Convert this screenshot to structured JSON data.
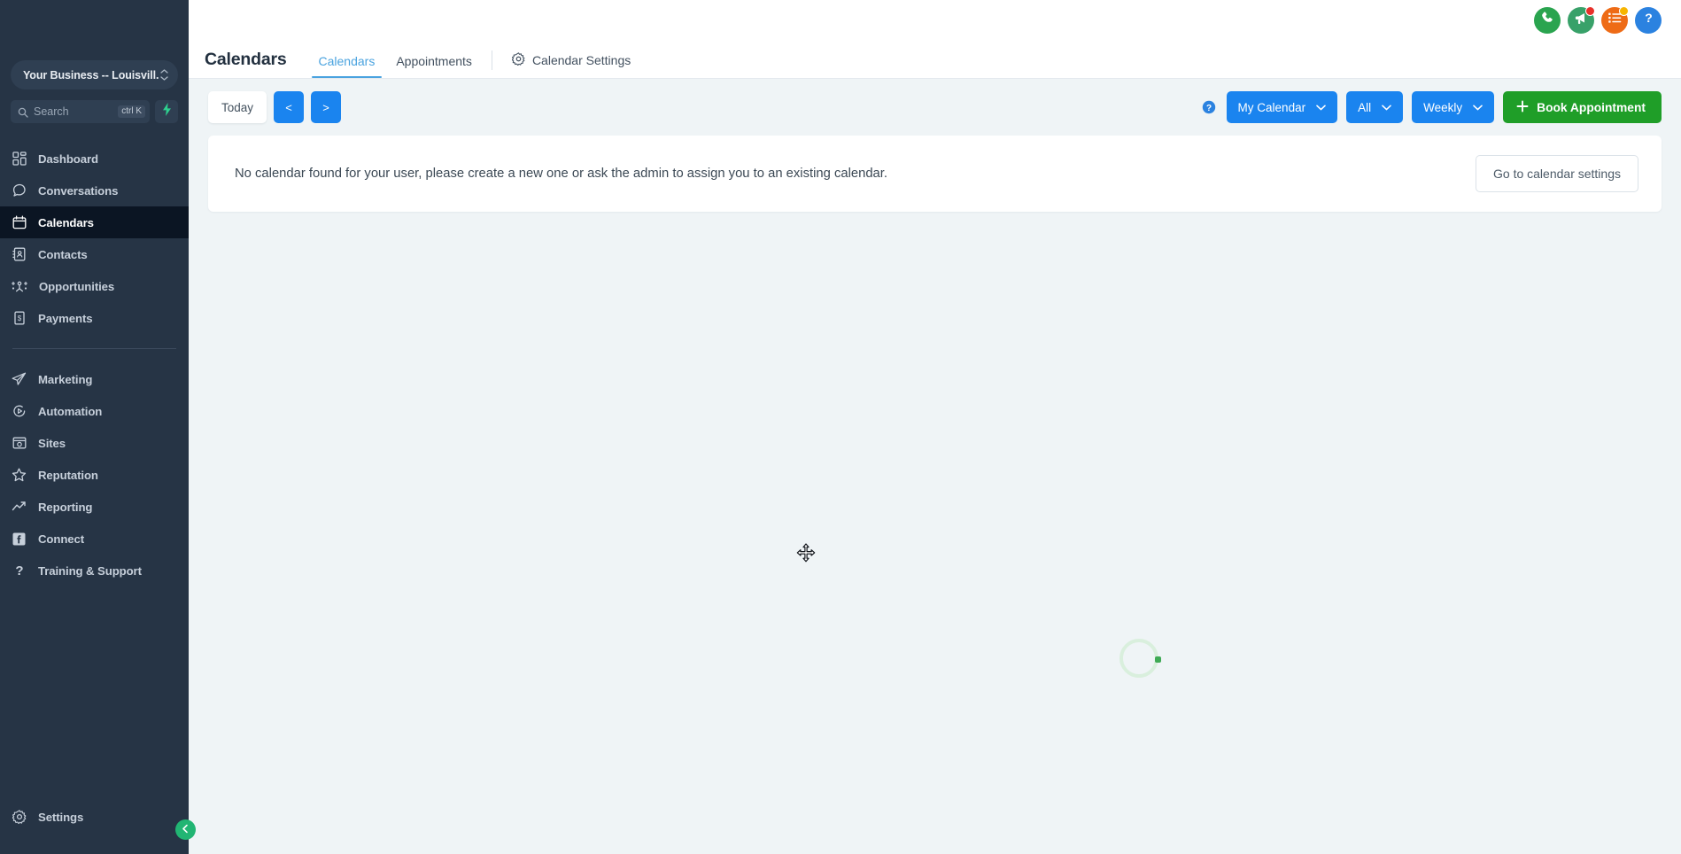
{
  "sidebar": {
    "business": {
      "name": "Your Business -- Louisvill...",
      "stepper_icon": "stepper-up-down-icon"
    },
    "search": {
      "placeholder": "Search",
      "shortcut": "ctrl K",
      "icon": "search-icon",
      "bolt_icon": "lightning-bolt-icon"
    },
    "items": [
      {
        "label": "Dashboard",
        "icon": "dashboard-grid-icon",
        "active": false
      },
      {
        "label": "Conversations",
        "icon": "chat-bubble-icon",
        "active": false
      },
      {
        "label": "Calendars",
        "icon": "calendar-icon",
        "active": true
      },
      {
        "label": "Contacts",
        "icon": "contacts-book-icon",
        "active": false
      },
      {
        "label": "Opportunities",
        "icon": "opportunities-nodes-icon",
        "active": false
      },
      {
        "label": "Payments",
        "icon": "payments-receipt-icon",
        "active": false
      }
    ],
    "items2": [
      {
        "label": "Marketing",
        "icon": "paper-plane-icon",
        "active": false
      },
      {
        "label": "Automation",
        "icon": "play-circle-icon",
        "active": false
      },
      {
        "label": "Sites",
        "icon": "sites-window-icon",
        "active": false
      },
      {
        "label": "Reputation",
        "icon": "star-icon",
        "active": false
      },
      {
        "label": "Reporting",
        "icon": "trend-up-icon",
        "active": false
      },
      {
        "label": "Connect",
        "icon": "facebook-icon",
        "active": false
      },
      {
        "label": "Training & Support",
        "icon": "question-mark-icon",
        "active": false
      }
    ],
    "settings": {
      "label": "Settings",
      "icon": "gear-icon"
    },
    "collapse": {
      "icon": "chevron-left-icon"
    }
  },
  "topbar": {
    "icons": [
      {
        "name": "phone-icon",
        "color": "#2aa44f",
        "badge": null
      },
      {
        "name": "megaphone-icon",
        "color": "#38a169",
        "badge": "#e8302a"
      },
      {
        "name": "tasks-list-icon",
        "color": "#ee6b16",
        "badge": "#f7b500"
      },
      {
        "name": "help-question-icon",
        "color": "#2b82e0",
        "badge": null
      }
    ]
  },
  "header": {
    "title": "Calendars",
    "tabs": [
      {
        "label": "Calendars",
        "active": true
      },
      {
        "label": "Appointments",
        "active": false
      },
      {
        "label": "Calendar Settings",
        "active": false,
        "icon": "gear-icon"
      }
    ]
  },
  "toolbar": {
    "today_label": "Today",
    "prev_label": "<",
    "next_label": ">",
    "help_icon": "help-question-icon",
    "calendar_select": "My Calendar",
    "filter_select": "All",
    "view_select": "Weekly",
    "book_label": "Book Appointment",
    "book_plus_icon": "plus-icon"
  },
  "notice": {
    "message": "No calendar found for your user, please create a new one or ask the admin to assign you to an existing calendar.",
    "action_label": "Go to calendar settings"
  },
  "canvas": {
    "spinner": "loading-spinner",
    "cursor": "move-cursor"
  },
  "colors": {
    "sidebar_bg": "#263445",
    "sidebar_active": "#0b1523",
    "accent_blue": "#1a84ef",
    "accent_green": "#1f9e28",
    "tab_active": "#4aa3df",
    "page_bg": "#eff4f6",
    "collapse_green": "#21b573"
  }
}
